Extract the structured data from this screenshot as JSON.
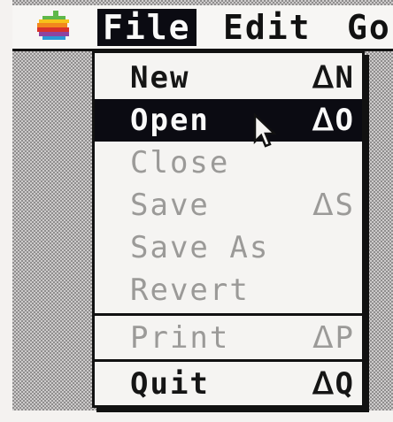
{
  "menubar": {
    "apple_icon": "apple-icon",
    "menus": [
      "File",
      "Edit",
      "Go"
    ],
    "active_menu": "File"
  },
  "file_menu": {
    "items": [
      {
        "label": "New",
        "shortcut": "ᐃN",
        "enabled": true
      },
      {
        "label": "Open",
        "shortcut": "ᐃO",
        "enabled": true,
        "highlighted": true
      },
      {
        "label": "Close",
        "shortcut": "",
        "enabled": false
      },
      {
        "label": "Save",
        "shortcut": "ᐃS",
        "enabled": false
      },
      {
        "label": "Save As",
        "shortcut": "",
        "enabled": false
      },
      {
        "label": "Revert",
        "shortcut": "",
        "enabled": false
      },
      {
        "label": "Print",
        "shortcut": "ᐃP",
        "enabled": false
      },
      {
        "label": "Quit",
        "shortcut": "ᐃQ",
        "enabled": true
      }
    ]
  },
  "colors": {
    "menu_highlight": "#0b0b12",
    "menu_background": "#f5f4f2",
    "disabled_text": "#9b9a98",
    "apple_logo": [
      "#5fb84a",
      "#f6c21a",
      "#f2871d",
      "#d9322b",
      "#8e44a0",
      "#2a9ad6"
    ]
  },
  "cursor": "arrow-cursor-icon"
}
